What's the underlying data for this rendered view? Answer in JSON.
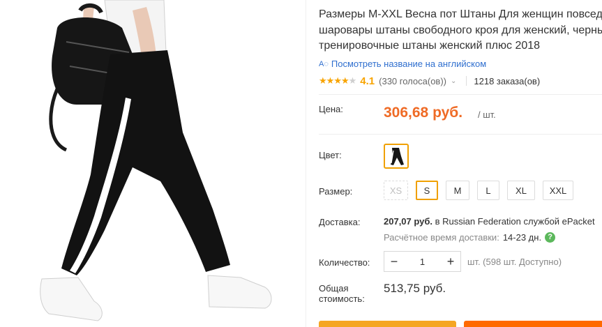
{
  "product": {
    "title_lines": [
      "Размеры M-XXL Весна пот Штаны Для женщин повседневные",
      "шаровары штаны свободного кроя для женский, черные",
      "тренировочные штаны женский плюс 2018"
    ],
    "translate_link": "Посмотреть название на английском",
    "translate_icon": "translate-icon"
  },
  "rating": {
    "stars_filled": 4,
    "stars_total": 5,
    "value": "4.1",
    "votes": "(330 голоса(ов))",
    "orders": "1218 заказа(ов)"
  },
  "price": {
    "label": "Цена:",
    "value": "306,68 руб.",
    "per_unit": "/ шт."
  },
  "color": {
    "label": "Цвет:"
  },
  "size": {
    "label": "Размер:",
    "options": [
      "XS",
      "S",
      "M",
      "L",
      "XL",
      "XXL"
    ],
    "selected": "S",
    "disabled": [
      "XS"
    ]
  },
  "shipping": {
    "label": "Доставка:",
    "price": "207,07 руб.",
    "destination_text": "в Russian Federation службой ePacket",
    "estimate_label": "Расчётное время доставки:",
    "estimate_value": "14-23 дн."
  },
  "quantity": {
    "label": "Количество:",
    "value": "1",
    "minus": "−",
    "plus": "+",
    "availability": "шт. (598 шт. Доступно)"
  },
  "total": {
    "label_line1": "Общая",
    "label_line2": "стоимость:",
    "value": "513,75 руб."
  },
  "colors": {
    "price_orange": "#ef6b26",
    "star": "#f8a400",
    "link": "#2f6fcf",
    "selected_border": "#f0a000",
    "buy_button": "#f5a623",
    "cart_button": "#ff6a00"
  }
}
